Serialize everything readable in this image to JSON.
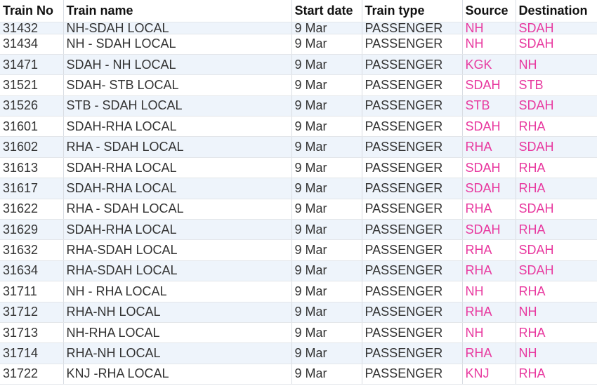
{
  "colors": {
    "station_code": "#e8399f",
    "row_stripe": "#eef4fb",
    "text": "#333333"
  },
  "columns": [
    "Train No",
    "Train name",
    "Start date",
    "Train type",
    "Source",
    "Destination"
  ],
  "rows": [
    {
      "no": "31432",
      "name": "NH-SDAH LOCAL",
      "date": "9 Mar",
      "type": "PASSENGER",
      "src": "NH",
      "dst": "SDAH"
    },
    {
      "no": "31434",
      "name": "NH - SDAH LOCAL",
      "date": "9 Mar",
      "type": "PASSENGER",
      "src": "NH",
      "dst": "SDAH"
    },
    {
      "no": "31471",
      "name": "SDAH - NH LOCAL",
      "date": "9 Mar",
      "type": "PASSENGER",
      "src": "KGK",
      "dst": "NH"
    },
    {
      "no": "31521",
      "name": "SDAH- STB LOCAL",
      "date": "9 Mar",
      "type": "PASSENGER",
      "src": "SDAH",
      "dst": "STB"
    },
    {
      "no": "31526",
      "name": "STB - SDAH LOCAL",
      "date": "9 Mar",
      "type": "PASSENGER",
      "src": "STB",
      "dst": "SDAH"
    },
    {
      "no": "31601",
      "name": "SDAH-RHA LOCAL",
      "date": "9 Mar",
      "type": "PASSENGER",
      "src": "SDAH",
      "dst": "RHA"
    },
    {
      "no": "31602",
      "name": "RHA - SDAH LOCAL",
      "date": "9 Mar",
      "type": "PASSENGER",
      "src": "RHA",
      "dst": "SDAH"
    },
    {
      "no": "31613",
      "name": "SDAH-RHA LOCAL",
      "date": "9 Mar",
      "type": "PASSENGER",
      "src": "SDAH",
      "dst": "RHA"
    },
    {
      "no": "31617",
      "name": "SDAH-RHA LOCAL",
      "date": "9 Mar",
      "type": "PASSENGER",
      "src": "SDAH",
      "dst": "RHA"
    },
    {
      "no": "31622",
      "name": "RHA - SDAH LOCAL",
      "date": "9 Mar",
      "type": "PASSENGER",
      "src": "RHA",
      "dst": "SDAH"
    },
    {
      "no": "31629",
      "name": "SDAH-RHA LOCAL",
      "date": "9 Mar",
      "type": "PASSENGER",
      "src": "SDAH",
      "dst": "RHA"
    },
    {
      "no": "31632",
      "name": "RHA-SDAH LOCAL",
      "date": "9 Mar",
      "type": "PASSENGER",
      "src": "RHA",
      "dst": "SDAH"
    },
    {
      "no": "31634",
      "name": "RHA-SDAH LOCAL",
      "date": "9 Mar",
      "type": "PASSENGER",
      "src": "RHA",
      "dst": "SDAH"
    },
    {
      "no": "31711",
      "name": "NH - RHA LOCAL",
      "date": "9 Mar",
      "type": "PASSENGER",
      "src": "NH",
      "dst": "RHA"
    },
    {
      "no": "31712",
      "name": "RHA-NH LOCAL",
      "date": "9 Mar",
      "type": "PASSENGER",
      "src": "RHA",
      "dst": "NH"
    },
    {
      "no": "31713",
      "name": "NH-RHA LOCAL",
      "date": "9 Mar",
      "type": "PASSENGER",
      "src": "NH",
      "dst": "RHA"
    },
    {
      "no": "31714",
      "name": "RHA-NH LOCAL",
      "date": "9 Mar",
      "type": "PASSENGER",
      "src": "RHA",
      "dst": "NH"
    },
    {
      "no": "31722",
      "name": "KNJ -RHA LOCAL",
      "date": "9 Mar",
      "type": "PASSENGER",
      "src": "KNJ",
      "dst": "RHA"
    }
  ]
}
